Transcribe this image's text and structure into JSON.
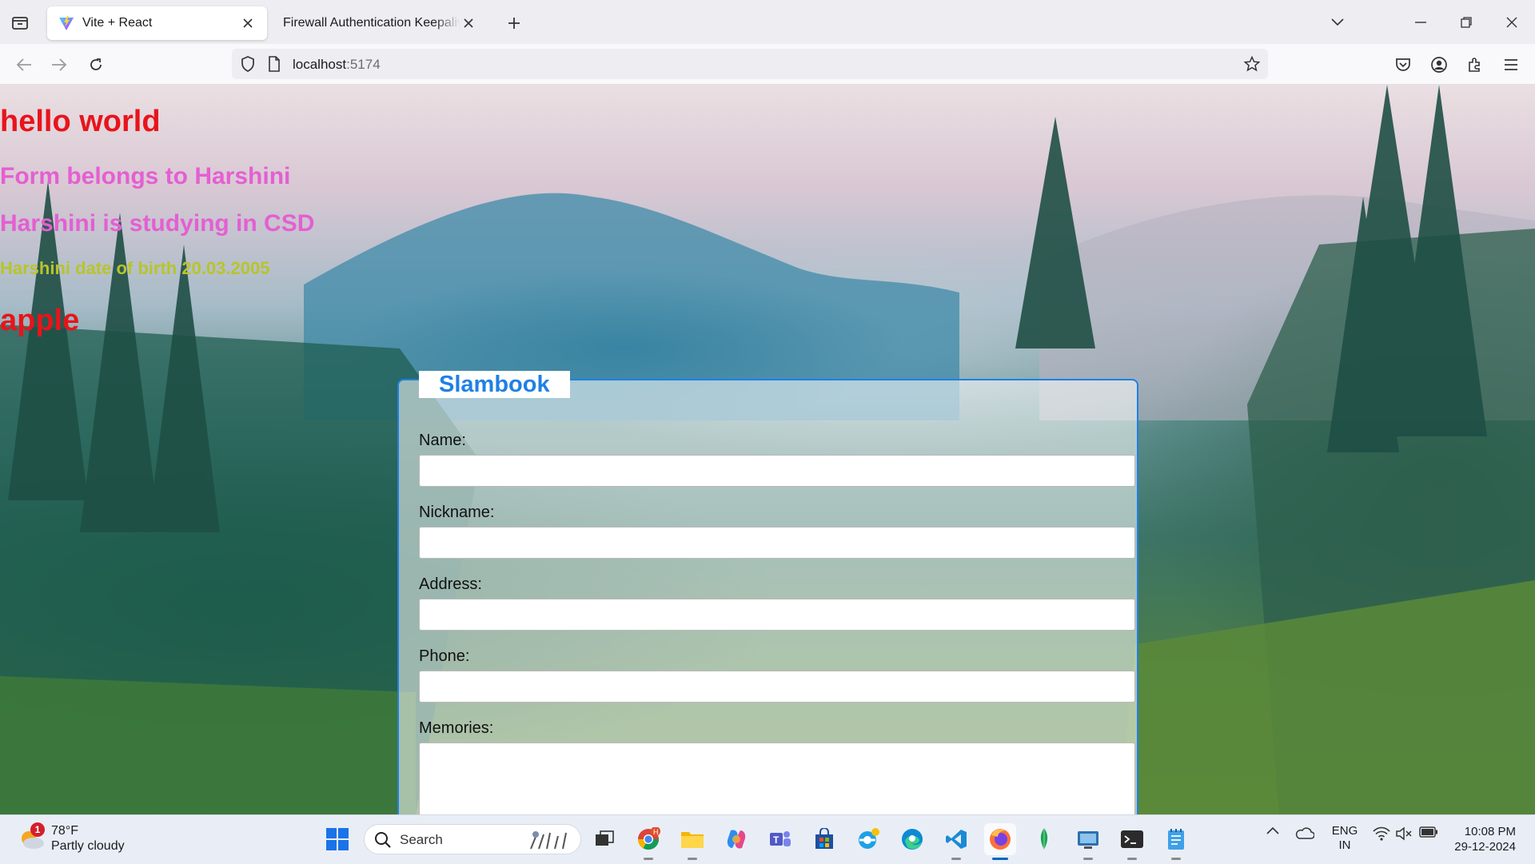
{
  "browser": {
    "tabs": [
      {
        "title": "Vite + React",
        "active": true
      },
      {
        "title": "Firewall Authentication Keepalive W",
        "active": false
      }
    ],
    "url": {
      "host": "localhost",
      "port": ":5174"
    }
  },
  "page": {
    "hello": "hello world",
    "belongs": "Form belongs to Harshini",
    "study": "Harshini is studying in CSD",
    "dob": "Harshini date of birth 20.03.2005",
    "apple": "apple",
    "form": {
      "legend": "Slambook",
      "fields": [
        {
          "label": "Name:",
          "value": ""
        },
        {
          "label": "Nickname:",
          "value": ""
        },
        {
          "label": "Address:",
          "value": ""
        },
        {
          "label": "Phone:",
          "value": ""
        },
        {
          "label": "Memories:",
          "value": ""
        }
      ]
    }
  },
  "taskbar": {
    "weather": {
      "temp": "78°F",
      "condition": "Partly cloudy",
      "badge": "1"
    },
    "search_placeholder": "Search",
    "chrome_badge": "H",
    "lang_line1": "ENG",
    "lang_line2": "IN",
    "time": "10:08 PM",
    "date": "29-12-2024"
  },
  "colors": {
    "accent": "#1f80e6",
    "hello": "#e8141b",
    "pink": "#e45fd2",
    "dob": "#b9c42a"
  }
}
